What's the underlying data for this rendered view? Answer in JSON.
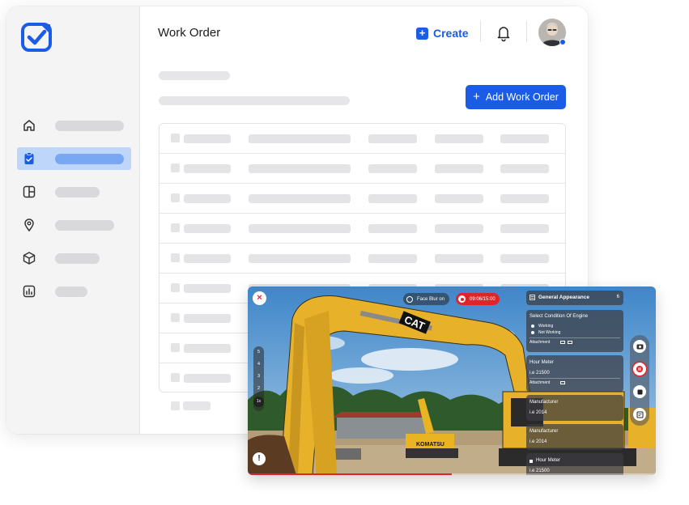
{
  "header": {
    "title": "Work Order",
    "create_label": "Create",
    "create_plus": "+"
  },
  "toolbar": {
    "add_label": "Add Work Order",
    "add_plus": "+"
  },
  "sidebar": {
    "logo": "checklist-logo",
    "items": [
      {
        "icon": "home-icon",
        "active": false
      },
      {
        "icon": "clipboard-check-icon",
        "active": true
      },
      {
        "icon": "layout-icon",
        "active": false
      },
      {
        "icon": "location-pin-icon",
        "active": false
      },
      {
        "icon": "box-icon",
        "active": false
      },
      {
        "icon": "analytics-icon",
        "active": false
      }
    ]
  },
  "colors": {
    "brand": "#1a5ce6",
    "active_nav_bg": "#bfd6fb",
    "record_red": "#e0242b"
  },
  "video": {
    "close_glyph": "×",
    "face_blur_label": "Face Blur on",
    "record_time": "09:06/15:00",
    "zoom_levels": [
      "5",
      "4",
      "3",
      "2"
    ],
    "zoom_current": "1x",
    "alert_glyph": "!",
    "brand_cat": "CAT",
    "brand_komatsu": "KOMATSU",
    "progress_fraction": 0.5,
    "checklist": {
      "section_title": "General Appearance",
      "section_count": "6",
      "question_1": {
        "title": "Select Condition Of Engine",
        "options": [
          "Working",
          "Not Working"
        ],
        "attachment_label": "Attachment"
      },
      "hour_meter": {
        "title": "Hour Meter",
        "value": "i.e 21500",
        "attachment_label": "Attachment"
      },
      "manufacturer_1": {
        "title": "Manufacturer",
        "value": "i.e 2014"
      },
      "manufacturer_2": {
        "title": "Manufacturer",
        "value": "i.e 2014"
      },
      "hour_meter_2": {
        "title": "Hour Meter",
        "value": "i.e 21500"
      }
    }
  }
}
